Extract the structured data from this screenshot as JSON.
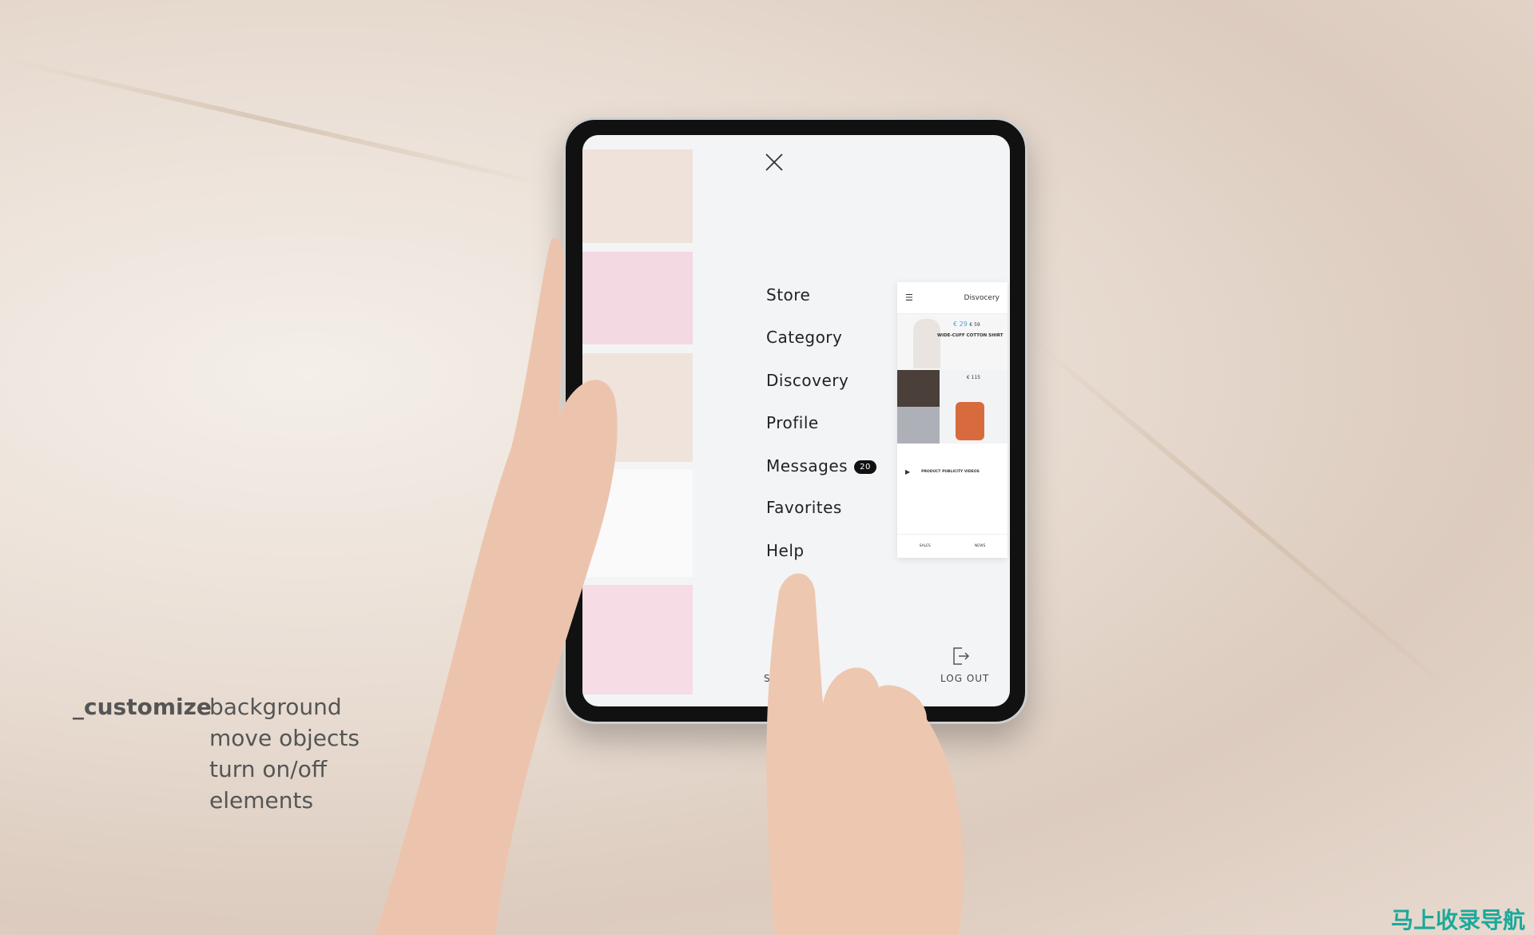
{
  "menu": {
    "close_icon": "close-icon",
    "items": [
      {
        "label": "Store"
      },
      {
        "label": "Category"
      },
      {
        "label": "Discovery"
      },
      {
        "label": "Profile"
      },
      {
        "label": "Messages",
        "badge": "20"
      },
      {
        "label": "Favorites"
      },
      {
        "label": "Help"
      }
    ]
  },
  "footer": {
    "settings_partial": "SE",
    "logout_label": "LOG OUT",
    "logout_icon": "logout-icon"
  },
  "mini_app": {
    "title": "Disvocery",
    "price": "€ 29",
    "old_price": "€ 59",
    "product_title": "WIDE-CUFF COTTON SHIRT",
    "price2": "€ 115",
    "video_title": "PRODUCT PUBLICITY VIDEOS",
    "tabs": [
      {
        "label": "SALES"
      },
      {
        "label": "NEWS"
      }
    ]
  },
  "caption": {
    "heading": "_customize",
    "lines": [
      "background",
      "move objects",
      "turn on/off",
      "elements"
    ]
  },
  "watermark": "马上收录导航",
  "colors": {
    "accent": "#4aa8d8",
    "badge": "#111111",
    "watermark": "#1aa99a"
  }
}
